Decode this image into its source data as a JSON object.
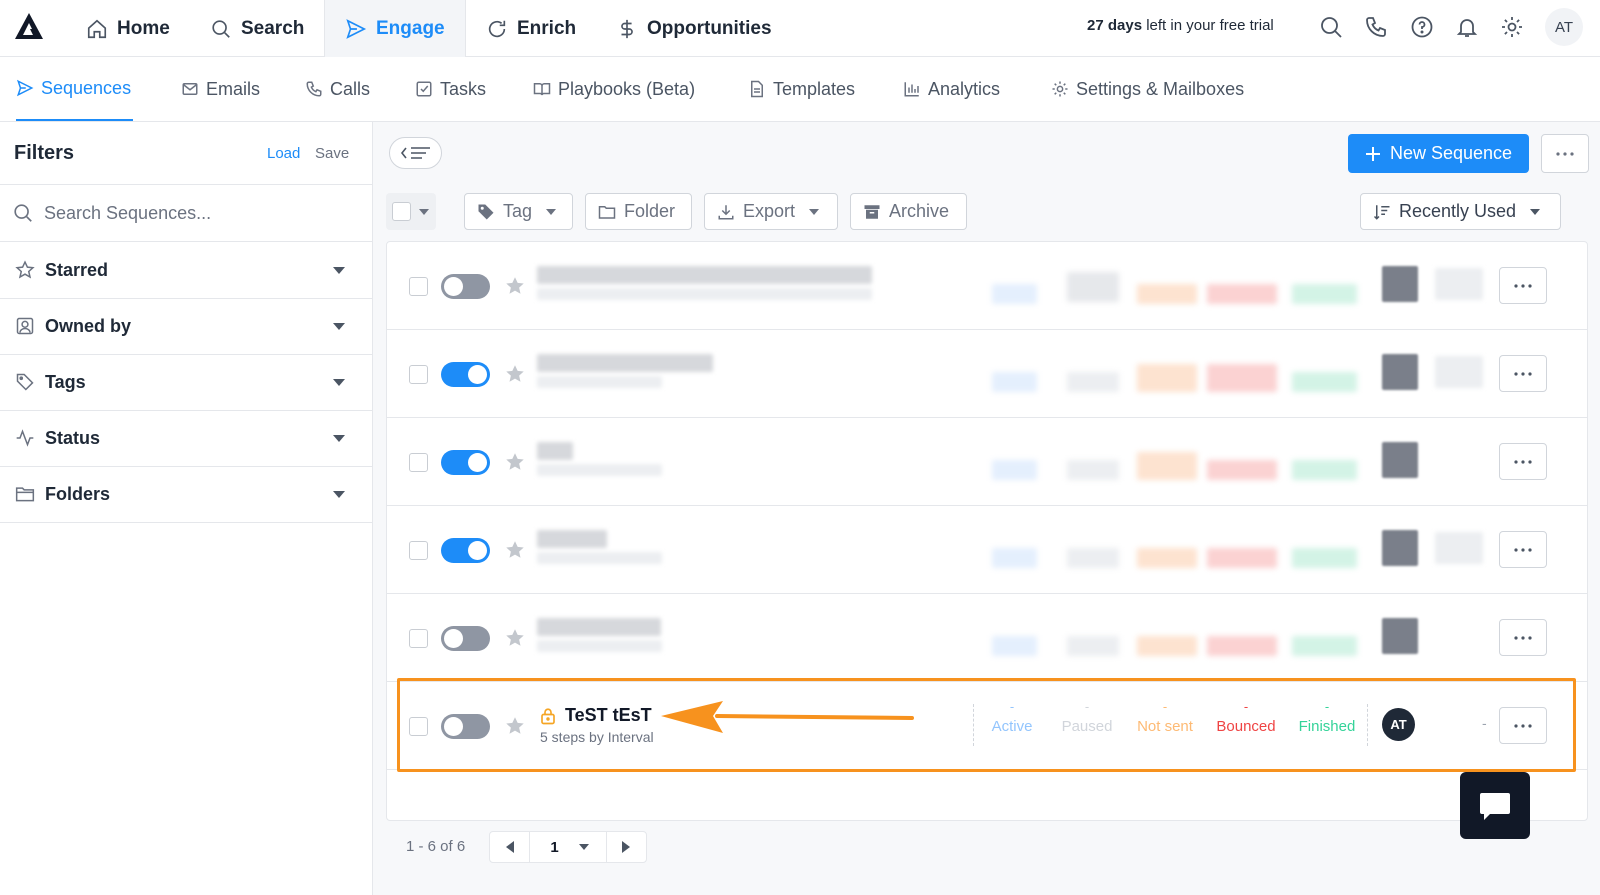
{
  "topnav": {
    "items": [
      {
        "label": "Home",
        "icon": "home-icon"
      },
      {
        "label": "Search",
        "icon": "search-icon"
      },
      {
        "label": "Engage",
        "icon": "send-icon",
        "active": true
      },
      {
        "label": "Enrich",
        "icon": "refresh-icon"
      },
      {
        "label": "Opportunities",
        "icon": "dollar-icon"
      }
    ],
    "trial_days": "27 days",
    "trial_rest": " left in your free trial",
    "avatar": "AT",
    "icons": [
      "search-icon",
      "phone-icon",
      "help-icon",
      "bell-icon",
      "gear-icon"
    ]
  },
  "subnav": {
    "items": [
      {
        "label": "Sequences",
        "icon": "send-icon",
        "active": true
      },
      {
        "label": "Emails",
        "icon": "mail-icon"
      },
      {
        "label": "Calls",
        "icon": "phone-icon"
      },
      {
        "label": "Tasks",
        "icon": "checkbox-icon"
      },
      {
        "label": "Playbooks (Beta)",
        "icon": "book-icon"
      },
      {
        "label": "Templates",
        "icon": "document-icon"
      },
      {
        "label": "Analytics",
        "icon": "bar-chart-icon"
      },
      {
        "label": "Settings & Mailboxes",
        "icon": "gear-icon"
      }
    ]
  },
  "sidebar": {
    "title": "Filters",
    "load": "Load",
    "save": "Save",
    "search_placeholder": "Search Sequences...",
    "filters": [
      {
        "label": "Starred",
        "icon": "star-icon"
      },
      {
        "label": "Owned by",
        "icon": "user-icon"
      },
      {
        "label": "Tags",
        "icon": "tag-icon"
      },
      {
        "label": "Status",
        "icon": "activity-icon"
      },
      {
        "label": "Folders",
        "icon": "folder-icon"
      }
    ]
  },
  "toolbar": {
    "new_sequence": "New Sequence",
    "tag": "Tag",
    "folder": "Folder",
    "export": "Export",
    "archive": "Archive",
    "sort": "Recently Used"
  },
  "rows": [
    {
      "enabled": false
    },
    {
      "enabled": true
    },
    {
      "enabled": true
    },
    {
      "enabled": true
    },
    {
      "enabled": false
    }
  ],
  "highlighted_row": {
    "name": "TeST tEsT",
    "subtitle": "5 steps by Interval",
    "enabled": false,
    "stats": [
      {
        "value": "-",
        "label": "Active",
        "color": "#93c5fd"
      },
      {
        "value": "-",
        "label": "Paused",
        "color": "#d1d5db"
      },
      {
        "value": "-",
        "label": "Not sent",
        "color": "#fdba74"
      },
      {
        "value": "-",
        "label": "Bounced",
        "color": "#ef4444"
      },
      {
        "value": "-",
        "label": "Finished",
        "color": "#34d399"
      }
    ],
    "owner_avatar": "AT",
    "last_col": "-"
  },
  "pagination": {
    "range": "1 - 6 of 6",
    "page": "1"
  },
  "colors": {
    "accent": "#1d8cf8",
    "highlight": "#f7921e"
  }
}
